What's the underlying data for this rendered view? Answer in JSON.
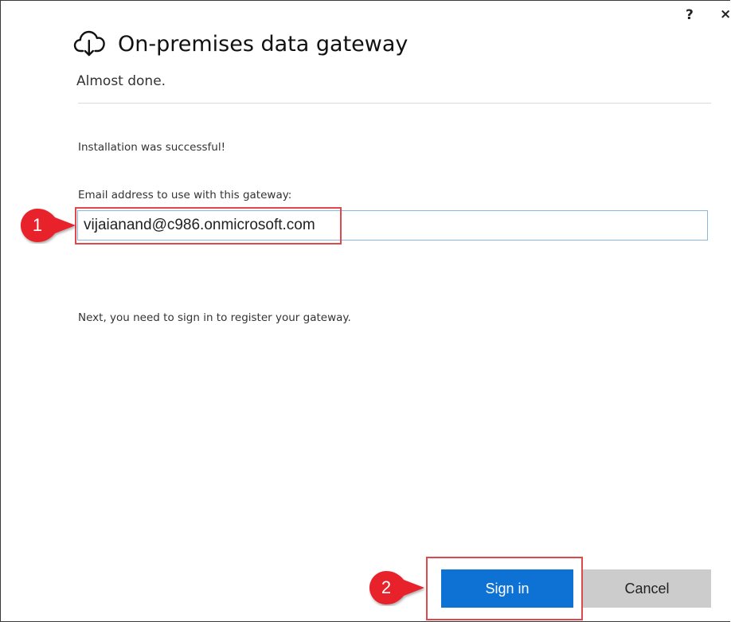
{
  "window": {
    "help_label": "?",
    "close_label": "×"
  },
  "header": {
    "icon": "cloud-upload-icon",
    "title": "On-premises data gateway",
    "subtitle": "Almost done."
  },
  "content": {
    "status_text": "Installation was successful!",
    "email_label": "Email address to use with this gateway:",
    "email_value": "vijaianand@c986.onmicrosoft.com",
    "next_text": "Next, you need to sign in to register your gateway."
  },
  "annotations": {
    "callout_1": "1",
    "callout_2": "2",
    "callout_color": "#e8222a",
    "highlight_color": "#e0494c"
  },
  "footer": {
    "sign_in_label": "Sign in",
    "cancel_label": "Cancel",
    "primary_color": "#0e72d5",
    "secondary_color": "#cccccc"
  }
}
